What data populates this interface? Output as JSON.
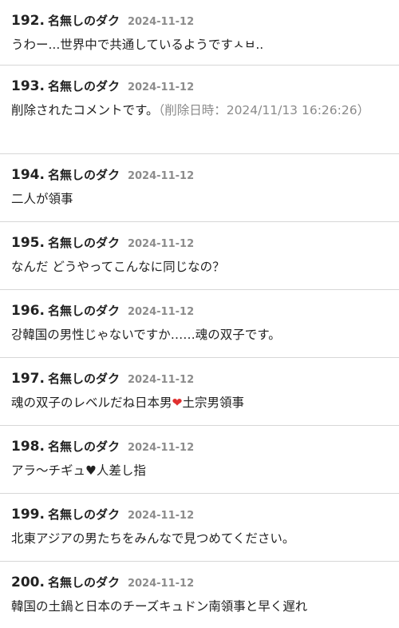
{
  "comments": [
    {
      "number": "192.",
      "author": "名無しのダク",
      "date": "2024-11-12",
      "text": "うわー...世界中で共通しているようです",
      "text_suffix": "ㅅㅂ.."
    },
    {
      "number": "193.",
      "author": "名無しのダク",
      "date": "2024-11-12",
      "text": "削除されたコメントです。",
      "deleted_note": "（削除日時：2024/11/13 16:26:26）"
    },
    {
      "number": "194.",
      "author": "名無しのダク",
      "date": "2024-11-12",
      "text": "二人が領事"
    },
    {
      "number": "195.",
      "author": "名無しのダク",
      "date": "2024-11-12",
      "text": "なんだ どうやってこんなに同じなの？"
    },
    {
      "number": "196.",
      "author": "名無しのダク",
      "date": "2024-11-12",
      "text": "강韓国の男性じゃないですか……魂の双子です。"
    },
    {
      "number": "197.",
      "author": "名無しのダク",
      "date": "2024-11-12",
      "text_before": "魂の双子のレベルだね日本男",
      "emoji": "❤",
      "text_after": "土宗男領事"
    },
    {
      "number": "198.",
      "author": "名無しのダク",
      "date": "2024-11-12",
      "text_before": "アラ～チギュ",
      "emoji": "♥",
      "text_after": "人差し指"
    },
    {
      "number": "199.",
      "author": "名無しのダク",
      "date": "2024-11-12",
      "text": "北東アジアの男たちをみんなで見つめてください。"
    },
    {
      "number": "200.",
      "author": "名無しのダク",
      "date": "2024-11-12",
      "text": "韓国の土鍋と日本のチーズキュドン南領事と早く遅れ"
    }
  ],
  "icons": {
    "heart_red": "heart-red-icon",
    "heart_black": "heart-black-icon"
  },
  "colors": {
    "text": "#222222",
    "date": "#8c8c8c",
    "deleted_note": "#8a8a8a",
    "divider": "#d7d7d7",
    "heart_red": "#e0302f"
  }
}
